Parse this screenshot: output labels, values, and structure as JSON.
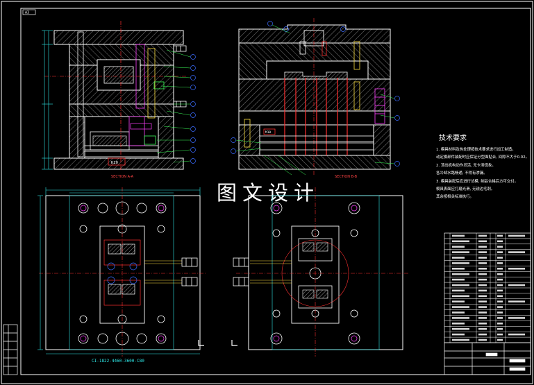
{
  "drawing": {
    "sheet_tag": "A3",
    "watermark": "图文设计",
    "section_labels": [
      "SECTION A-A",
      "SECTION B-B"
    ],
    "part_code": "CI-1822-4460-3600-C80",
    "callout_tag_left": "K10",
    "callout_tag_right": "M10"
  },
  "notes": {
    "title": "技术要求",
    "items": [
      "1. 模具材料及热处理按技术要求进行加工制造。",
      "   动定模部件装配时应保证分型面贴合, 间隙不大于0.02。",
      "2. 顶出机构动作灵活, 无卡滞现象。",
      "   各冷却水路畅通, 不得有渗漏。",
      "3. 模具装配后应进行试模, 制品合格后方可交付。",
      "   模具表面应打磨光滑, 无锐边毛刺。",
      "   其余按相关标准执行。"
    ]
  },
  "colors": {
    "background": "#000000",
    "frame": "#ffffff",
    "part": "#ffffff",
    "hatch": "#9a9a9a",
    "accent_red": "#ff3030",
    "accent_cyan": "#2ee8e8",
    "accent_blue": "#3a6bff",
    "accent_yellow": "#ffe040",
    "accent_green": "#3cff5a",
    "accent_magenta": "#ff40ff"
  }
}
